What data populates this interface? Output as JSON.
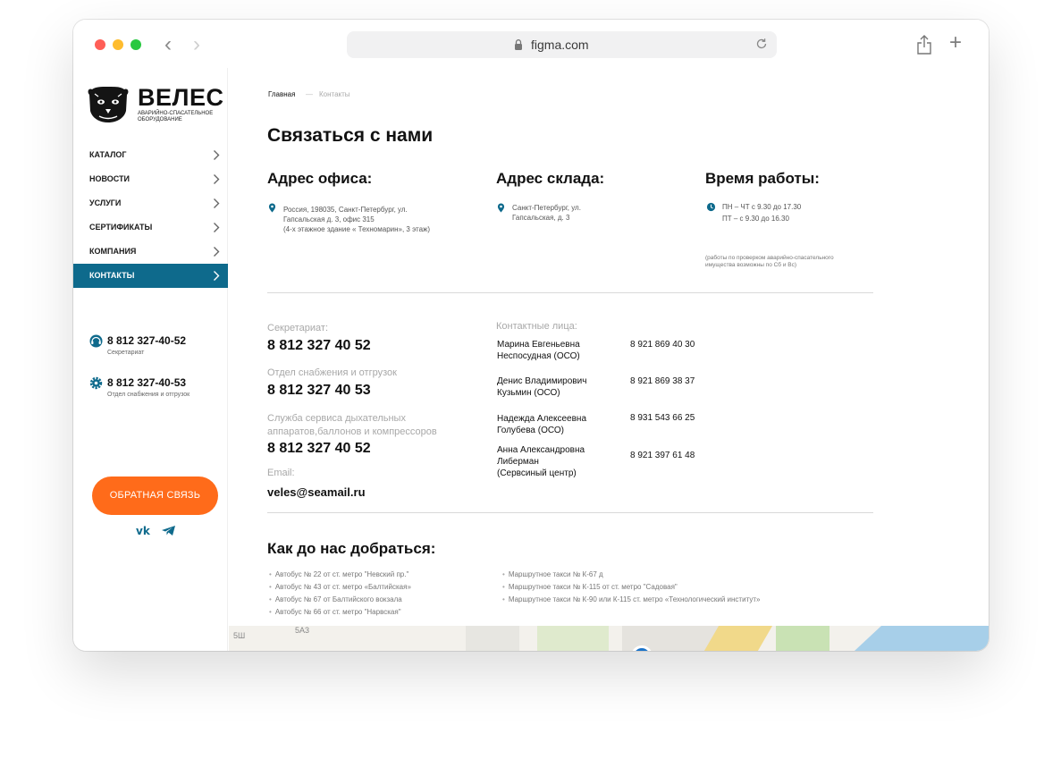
{
  "browser": {
    "url": "figma.com"
  },
  "sidebar": {
    "logo_title": "ВЕЛЕС",
    "logo_subtitle": "Аварийно-спасательное оборудование",
    "menu": [
      {
        "label": "КАТАЛОГ"
      },
      {
        "label": "НОВОСТИ"
      },
      {
        "label": "УСЛУГИ"
      },
      {
        "label": "СЕРТИФИКАТЫ"
      },
      {
        "label": "КОМПАНИЯ"
      },
      {
        "label": "КОНТАКТЫ"
      }
    ],
    "phones": [
      {
        "number": "8 812 327-40-52",
        "label": "Секретариат"
      },
      {
        "number": "8 812 327-40-53",
        "label": "Отдел снабжения и отгрузок"
      }
    ],
    "feedback_label": "ОБРАТНАЯ СВЯЗЬ"
  },
  "breadcrumb": {
    "home": "Главная",
    "sep": "—",
    "current": "Контакты"
  },
  "page_title": "Связаться с нами",
  "office": {
    "title": "Адрес офиса:",
    "lines": [
      "Россия, 198035, Санкт-Петербург, ул.",
      "Гапсальская д. 3, офис 315",
      "(4-х этажное здание « Техномарин», 3 этаж)"
    ]
  },
  "warehouse": {
    "title": "Адрес склада:",
    "lines": [
      "Санкт-Петербург, ул.",
      "Гапсальская, д. 3"
    ]
  },
  "hours": {
    "title": "Время работы:",
    "lines": [
      "ПН – ЧТ с 9.30 до 17.30",
      "ПТ – с 9.30 до 16.30"
    ],
    "note": [
      "(работы по проверком аварийно-спасательного",
      "имущества возможны по Сб и Вс)"
    ]
  },
  "departments": [
    {
      "label": "Секретариат:",
      "phone": "8 812 327 40 52"
    },
    {
      "label": "Отдел снабжения и отгрузок",
      "phone": "8 812 327 40 53"
    },
    {
      "label_lines": [
        "Служба сервиса дыхательных",
        "аппаратов,баллонов и компрессоров"
      ],
      "phone": "8 812 327 40 52"
    }
  ],
  "email": {
    "label": "Email:",
    "value": "veles@seamail.ru"
  },
  "contacts": {
    "label": "Контактные лица:",
    "people": [
      {
        "name_lines": [
          "Марина Евгеньевна",
          "Неспосудная (ОСО)"
        ],
        "phone": "8 921 869 40 30"
      },
      {
        "name_lines": [
          "Денис Владимирович",
          "Кузьмин (ОСО)"
        ],
        "phone": "8 921 869 38 37"
      },
      {
        "name_lines": [
          "Надежда Алексеевна",
          "Голубева (ОСО)"
        ],
        "phone": "8 931 543 66 25"
      },
      {
        "name_lines": [
          "Анна Александровна",
          "Либерман",
          "(Сервсиный центр)"
        ],
        "phone": "8 921 397 61 48"
      }
    ]
  },
  "route": {
    "title": "Как до нас добраться:",
    "left": [
      "Автобус № 22 от ст. метро \"Невский пр.\"",
      "Автобус № 43 от ст. метро «Балтийская»",
      "Автобус № 67 от Балтийского вокзала",
      "Автобус № 66 от ст. метро \"Нарвская\""
    ],
    "right": [
      "Маршрутное такси № К-67 д",
      "Маршрутное такси № К-115  от ст. метро \"Садовая\"",
      "Маршрутное такси № К-90 или К-115 ст. метро «Технологический институт»"
    ]
  },
  "map": {
    "labels": [
      "5Ш",
      "5А3"
    ]
  },
  "colors": {
    "accent": "#0e6a8c",
    "feedback": "#ff6b1a"
  }
}
